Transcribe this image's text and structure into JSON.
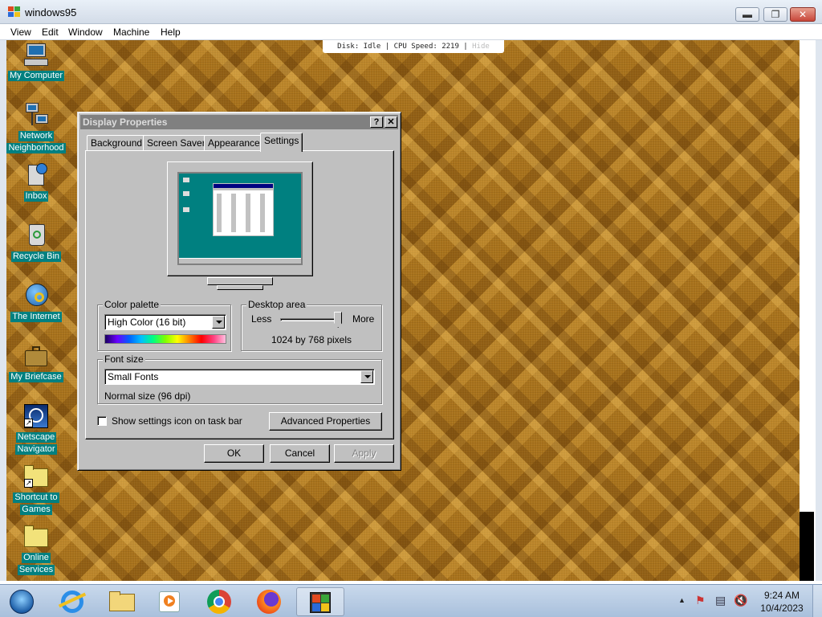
{
  "host": {
    "title": "windows95",
    "menu": [
      "View",
      "Edit",
      "Window",
      "Machine",
      "Help"
    ],
    "window_buttons": {
      "minimize": "▬",
      "maximize": "❐",
      "close": "✕"
    }
  },
  "statusbar": {
    "text": "Disk: Idle | CPU Speed: 2219 | ",
    "hide": "Hide"
  },
  "desktop_icons": [
    {
      "label": "My Computer",
      "icon": "computer-icon"
    },
    {
      "label": "Network Neighborhood",
      "line1": "Network",
      "line2": "Neighborhood",
      "icon": "network-icon"
    },
    {
      "label": "Inbox",
      "icon": "inbox-icon"
    },
    {
      "label": "Recycle Bin",
      "icon": "recycle-bin-icon"
    },
    {
      "label": "The Internet",
      "icon": "internet-icon"
    },
    {
      "label": "My Briefcase",
      "icon": "briefcase-icon"
    },
    {
      "label": "Netscape Navigator",
      "line1": "Netscape",
      "line2": "Navigator",
      "icon": "netscape-icon"
    },
    {
      "label": "Shortcut to Games",
      "line1": "Shortcut to",
      "line2": "Games",
      "icon": "folder-shortcut-icon"
    },
    {
      "label": "Online Services",
      "line1": "Online",
      "line2": "Services",
      "icon": "folder-icon"
    }
  ],
  "dialog": {
    "title": "Display Properties",
    "help": "?",
    "close": "✕",
    "tabs": [
      "Background",
      "Screen Saver",
      "Appearance",
      "Settings"
    ],
    "active_tab": "Settings",
    "color_palette": {
      "label": "Color palette",
      "value": "High Color (16 bit)"
    },
    "desktop_area": {
      "label": "Desktop area",
      "less": "Less",
      "more": "More",
      "value": "1024 by 768 pixels",
      "slider_level": 0.95
    },
    "font_size": {
      "label": "Font size",
      "value": "Small Fonts",
      "note": "Normal size (96 dpi)"
    },
    "checkbox": {
      "label": "Show settings icon on task bar",
      "checked": false
    },
    "advanced_button": "Advanced Properties",
    "ok": "OK",
    "cancel": "Cancel",
    "apply": "Apply"
  },
  "taskbar": {
    "apps": [
      "start-orb-icon",
      "internet-explorer-icon",
      "file-explorer-icon",
      "media-player-icon",
      "chrome-icon",
      "firefox-icon",
      "windows95-app-icon"
    ],
    "time": "9:24 AM",
    "date": "10/4/2023"
  },
  "colors": {
    "desktop_teal": "#008080",
    "title_inactive": "#808080",
    "face": "#c0c0c0"
  }
}
